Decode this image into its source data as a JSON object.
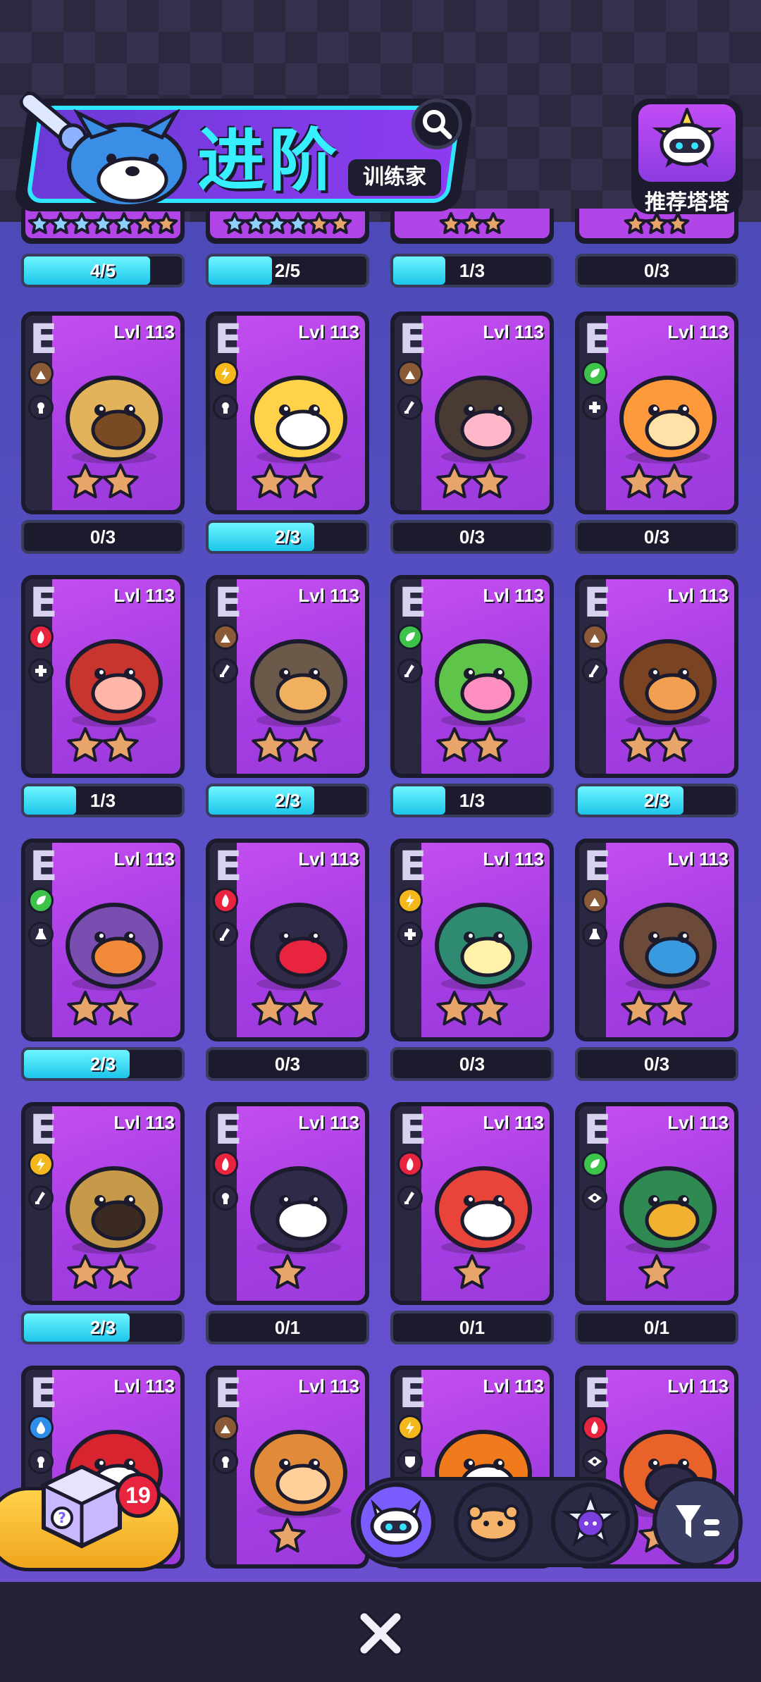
{
  "header": {
    "title": "进阶",
    "subtitle": "训练家",
    "recommend_label": "推荐塔塔"
  },
  "top_row_partial": [
    {
      "progress": "4/5",
      "fill": 0.8
    },
    {
      "progress": "2/5",
      "fill": 0.4
    },
    {
      "progress": "1/3",
      "fill": 0.33
    },
    {
      "progress": "0/3",
      "fill": 0
    }
  ],
  "cards": [
    {
      "grade": "E",
      "level": "Lvl 113",
      "element": "rock",
      "role": "support",
      "pet": "turtle",
      "stars": 2,
      "progress": "0/3",
      "fill": 0
    },
    {
      "grade": "E",
      "level": "Lvl 113",
      "element": "lightning",
      "role": "support",
      "pet": "fox",
      "stars": 2,
      "progress": "2/3",
      "fill": 0.67
    },
    {
      "grade": "E",
      "level": "Lvl 113",
      "element": "rock",
      "role": "attack",
      "pet": "mole",
      "stars": 2,
      "progress": "0/3",
      "fill": 0
    },
    {
      "grade": "E",
      "level": "Lvl 113",
      "element": "nature",
      "role": "heal",
      "pet": "flower",
      "stars": 2,
      "progress": "0/3",
      "fill": 0
    },
    {
      "grade": "E",
      "level": "Lvl 113",
      "element": "fire",
      "role": "heal",
      "pet": "pepper-pot",
      "stars": 2,
      "progress": "1/3",
      "fill": 0.33
    },
    {
      "grade": "E",
      "level": "Lvl 113",
      "element": "rock",
      "role": "attack",
      "pet": "snail",
      "stars": 2,
      "progress": "2/3",
      "fill": 0.67
    },
    {
      "grade": "E",
      "level": "Lvl 113",
      "element": "nature",
      "role": "attack",
      "pet": "cactus",
      "stars": 2,
      "progress": "1/3",
      "fill": 0.33
    },
    {
      "grade": "E",
      "level": "Lvl 113",
      "element": "rock",
      "role": "attack",
      "pet": "beetle",
      "stars": 2,
      "progress": "2/3",
      "fill": 0.67
    },
    {
      "grade": "E",
      "level": "Lvl 113",
      "element": "nature",
      "role": "potion",
      "pet": "mushroom",
      "stars": 2,
      "progress": "2/3",
      "fill": 0.67
    },
    {
      "grade": "E",
      "level": "Lvl 113",
      "element": "fire",
      "role": "attack",
      "pet": "fire-cat",
      "stars": 2,
      "progress": "0/3",
      "fill": 0
    },
    {
      "grade": "E",
      "level": "Lvl 113",
      "element": "lightning",
      "role": "heal",
      "pet": "orb-bird",
      "stars": 2,
      "progress": "0/3",
      "fill": 0
    },
    {
      "grade": "E",
      "level": "Lvl 113",
      "element": "rock",
      "role": "potion",
      "pet": "raccoon",
      "stars": 2,
      "progress": "0/3",
      "fill": 0
    },
    {
      "grade": "E",
      "level": "Lvl 113",
      "element": "lightning",
      "role": "attack",
      "pet": "lion-cage",
      "stars": 2,
      "progress": "2/3",
      "fill": 0.67
    },
    {
      "grade": "E",
      "level": "Lvl 113",
      "element": "fire",
      "role": "support",
      "pet": "shiba",
      "stars": 1,
      "progress": "0/1",
      "fill": 0
    },
    {
      "grade": "E",
      "level": "Lvl 113",
      "element": "fire",
      "role": "attack",
      "pet": "red-fox",
      "stars": 1,
      "progress": "0/1",
      "fill": 0
    },
    {
      "grade": "E",
      "level": "Lvl 113",
      "element": "nature",
      "role": "eye",
      "pet": "leaf-lizard",
      "stars": 1,
      "progress": "0/1",
      "fill": 0
    },
    {
      "grade": "E",
      "level": "Lvl 113",
      "element": "water",
      "role": "support",
      "pet": "mushroom-red",
      "stars": 1,
      "progress": "",
      "fill": 0
    },
    {
      "grade": "E",
      "level": "Lvl 113",
      "element": "rock",
      "role": "support",
      "pet": "kangaroo",
      "stars": 1,
      "progress": "",
      "fill": 0
    },
    {
      "grade": "E",
      "level": "Lvl 113",
      "element": "lightning",
      "role": "shield",
      "pet": "toucan",
      "stars": 1,
      "progress": "",
      "fill": 0
    },
    {
      "grade": "E",
      "level": "Lvl 113",
      "element": "fire",
      "role": "eye",
      "pet": "tiger",
      "stars": 1,
      "progress": "",
      "fill": 0
    }
  ],
  "bottom": {
    "gift_count": "19",
    "tabs": [
      "cat-robot",
      "bread-pet",
      "star-cat"
    ],
    "active_tab": 0
  },
  "colors": {
    "accent_cyan": "#2ee6ff",
    "card_purple": "#b145e8",
    "rock": "#8a5a36",
    "lightning": "#f5b81c",
    "nature": "#3cc44a",
    "fire": "#e8243e",
    "water": "#2f8ee8"
  }
}
